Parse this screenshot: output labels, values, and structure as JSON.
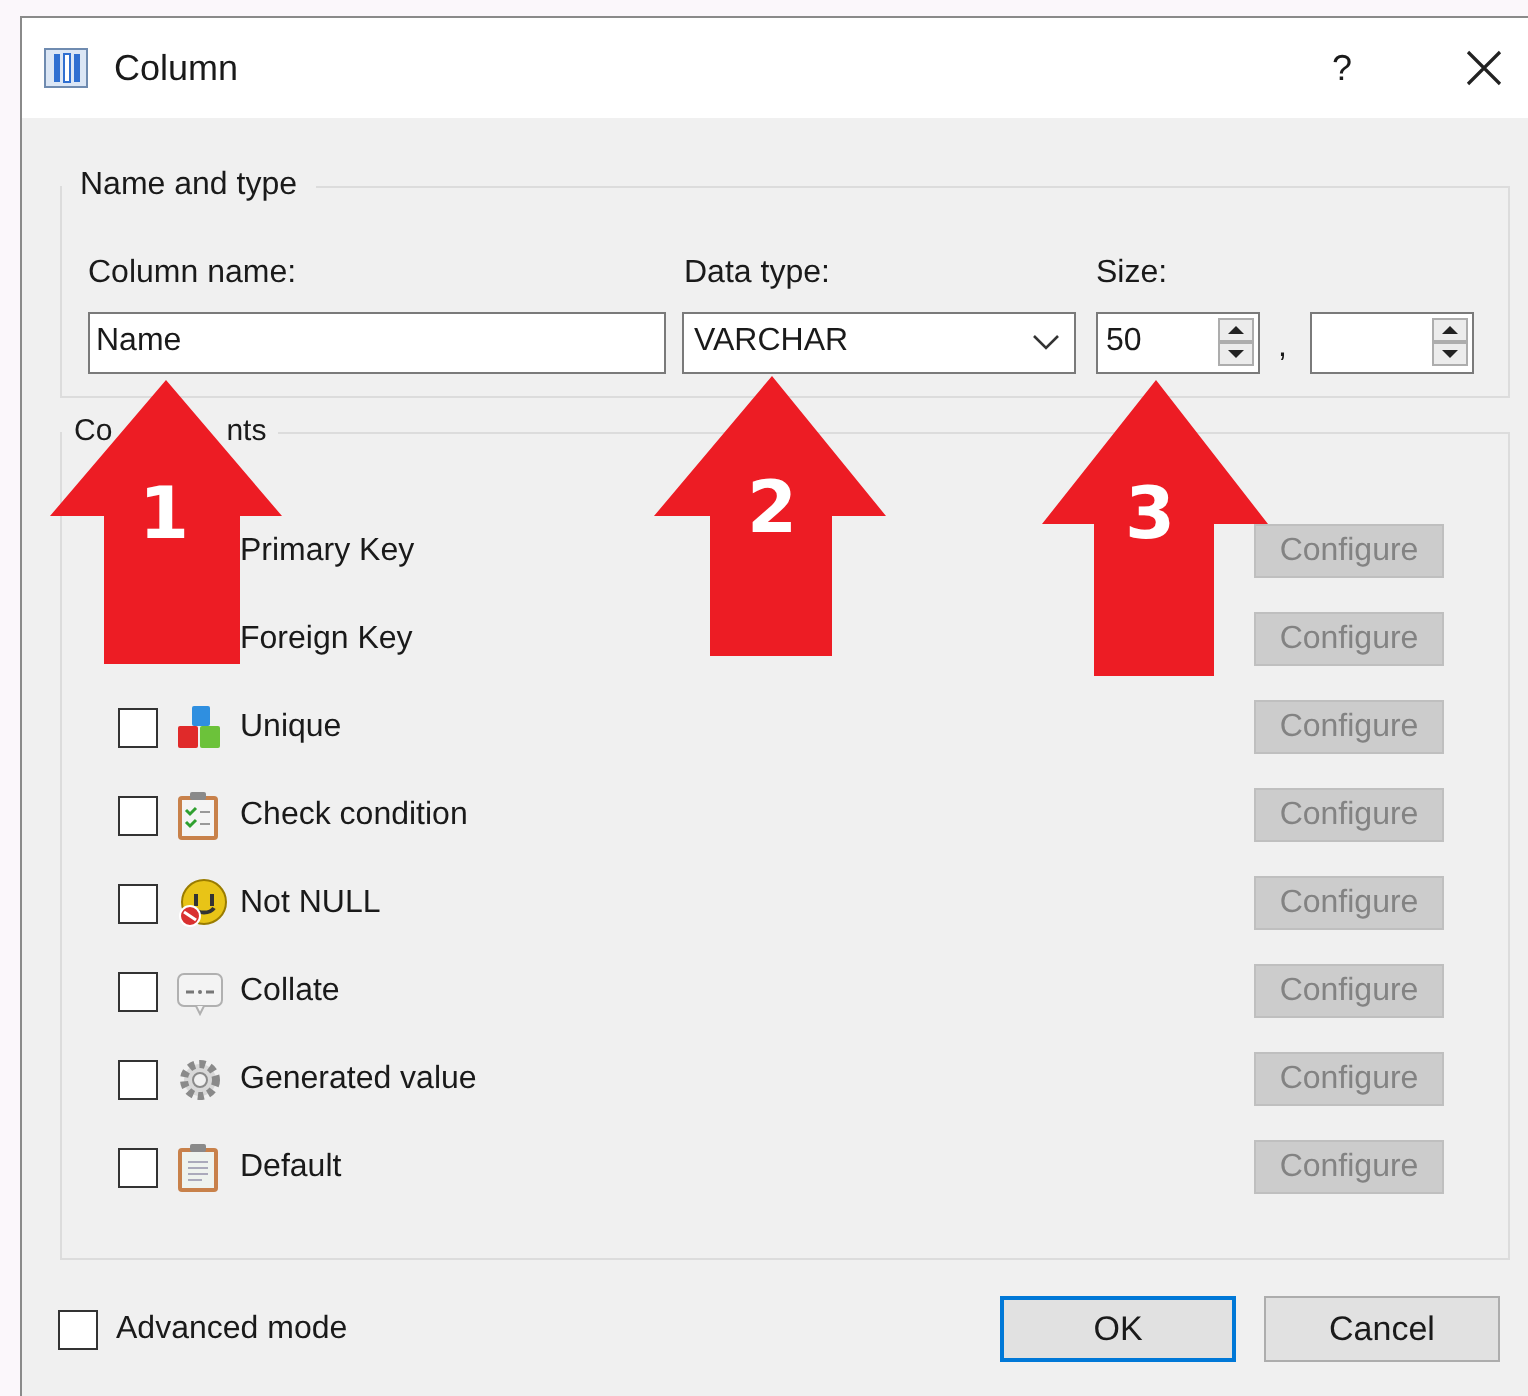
{
  "window": {
    "title": "Column",
    "help": "?"
  },
  "name_and_type": {
    "title": "Name and type",
    "column_name_label": "Column name:",
    "column_name_value": "Name",
    "data_type_label": "Data type:",
    "data_type_value": "VARCHAR",
    "size_label": "Size:",
    "size_value": "50",
    "separator": ","
  },
  "constraints": {
    "title_parts": [
      "Co",
      "nts"
    ],
    "rows": [
      {
        "label": "Primary Key",
        "configure": "Configure",
        "disabled": true
      },
      {
        "label": "Foreign Key",
        "configure": "Configure",
        "disabled": true
      },
      {
        "label": "Unique",
        "checked": false,
        "configure": "Configure",
        "disabled": true
      },
      {
        "label": "Check condition",
        "checked": false,
        "configure": "Configure",
        "disabled": true
      },
      {
        "label": "Not NULL",
        "checked": false,
        "configure": "Configure",
        "disabled": true
      },
      {
        "label": "Collate",
        "checked": false,
        "configure": "Configure",
        "disabled": true
      },
      {
        "label": "Generated value",
        "checked": false,
        "configure": "Configure",
        "disabled": true
      },
      {
        "label": "Default",
        "checked": false,
        "configure": "Configure",
        "disabled": true
      }
    ]
  },
  "advanced_mode": {
    "label": "Advanced mode",
    "checked": false
  },
  "buttons": [
    {
      "label": "OK",
      "selected": true
    },
    {
      "label": "Cancel",
      "selected": false
    }
  ],
  "annotations": [
    {
      "number": "1"
    },
    {
      "number": "2"
    },
    {
      "number": "3"
    }
  ]
}
